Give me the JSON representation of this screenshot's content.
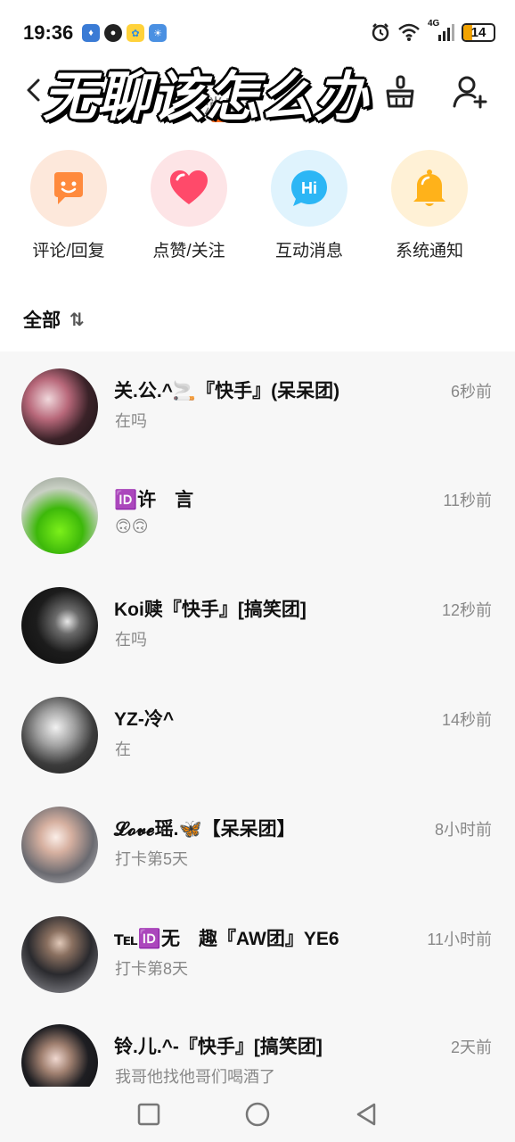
{
  "status_bar": {
    "time": "19:36",
    "network": "4G",
    "battery": "14"
  },
  "header": {
    "caption": "无聊该怎么办",
    "tab_label": "消息"
  },
  "quick_actions": [
    {
      "label": "评论/回复",
      "icon": "comment-icon",
      "color": "#ff8a3d",
      "bg": "#fde8db"
    },
    {
      "label": "点赞/关注",
      "icon": "heart-icon",
      "color": "#ff4a6a",
      "bg": "#fde4e6"
    },
    {
      "label": "互动消息",
      "icon": "hi-icon",
      "color": "#2cb6f5",
      "bg": "#dff3fd"
    },
    {
      "label": "系统通知",
      "icon": "bell-icon",
      "color": "#ffb21a",
      "bg": "#fff1d6"
    }
  ],
  "filter": {
    "label": "全部",
    "sort_icon": "⇅"
  },
  "messages": [
    {
      "name": "关.公.^🚬『快手』(呆呆团)",
      "time": "6秒前",
      "preview": "在吗"
    },
    {
      "name": "🆔许　言",
      "time": "11秒前",
      "preview": "🙃🙃"
    },
    {
      "name": "Koi赎『快手』[搞笑团]",
      "time": "12秒前",
      "preview": "在吗"
    },
    {
      "name": "YZ-冷^",
      "time": "14秒前",
      "preview": "在"
    },
    {
      "name": "𝓛𝓸𝓿𝓮瑶.🦋【呆呆团】",
      "time": "8小时前",
      "preview": "打卡第5天"
    },
    {
      "name": "℡🆔无　趣『AW团』YE6",
      "time": "11小时前",
      "preview": "打卡第8天"
    },
    {
      "name": "铃.儿.^-『快手』[搞笑团]",
      "time": "2天前",
      "preview": "我哥他找他哥们喝酒了"
    }
  ]
}
